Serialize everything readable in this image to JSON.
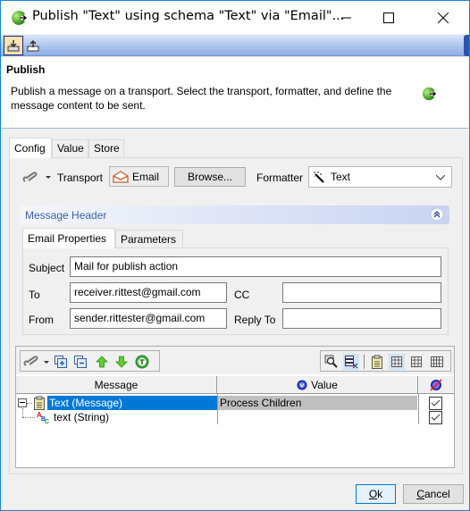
{
  "window": {
    "title": "Publish \"Text\" using schema \"Text\" via \"Email\"...",
    "controls": {
      "minimize": "minimize",
      "maximize": "maximize",
      "close": "close"
    }
  },
  "toolstrip": {
    "buttons": [
      {
        "name": "import-icon",
        "active": true
      },
      {
        "name": "export-icon",
        "active": false
      }
    ]
  },
  "info": {
    "heading": "Publish",
    "description": "Publish a message on a transport. Select the transport, formatter, and define the message content to be sent."
  },
  "tabs": [
    {
      "label": "Config",
      "selected": true
    },
    {
      "label": "Value",
      "selected": false
    },
    {
      "label": "Store",
      "selected": false
    }
  ],
  "config": {
    "transport_label": "Transport",
    "transport_value": "Email",
    "browse_label": "Browse...",
    "formatter_label": "Formatter",
    "formatter_value": "Text"
  },
  "message_header": {
    "title": "Message Header",
    "tabs": [
      {
        "label": "Email Properties",
        "selected": true
      },
      {
        "label": "Parameters",
        "selected": false
      }
    ],
    "fields": {
      "subject_label": "Subject",
      "subject_value": "Mail for publish action",
      "to_label": "To",
      "to_value": "receiver.rittest@gmail.com",
      "cc_label": "CC",
      "cc_value": "",
      "from_label": "From",
      "from_value": "sender.rittester@gmail.com",
      "replyto_label": "Reply To",
      "replyto_value": ""
    }
  },
  "message_tree": {
    "columns": {
      "message": "Message",
      "value": "Value"
    },
    "rows": [
      {
        "label": "Text (Message)",
        "value": "Process Children",
        "checked": true,
        "selected": true,
        "expanded": true,
        "level": 0
      },
      {
        "label": "text (String)",
        "value": "",
        "checked": true,
        "selected": false,
        "level": 1
      }
    ]
  },
  "footer": {
    "ok_mnemonic": "O",
    "ok_rest": "k",
    "cancel_mnemonic": "C",
    "cancel_rest": "ancel"
  },
  "colors": {
    "selection": "#0078d7",
    "value_highlight": "#bfbfbf",
    "section_header_text": "#3a5fa8",
    "window_border": "#1883d7"
  }
}
